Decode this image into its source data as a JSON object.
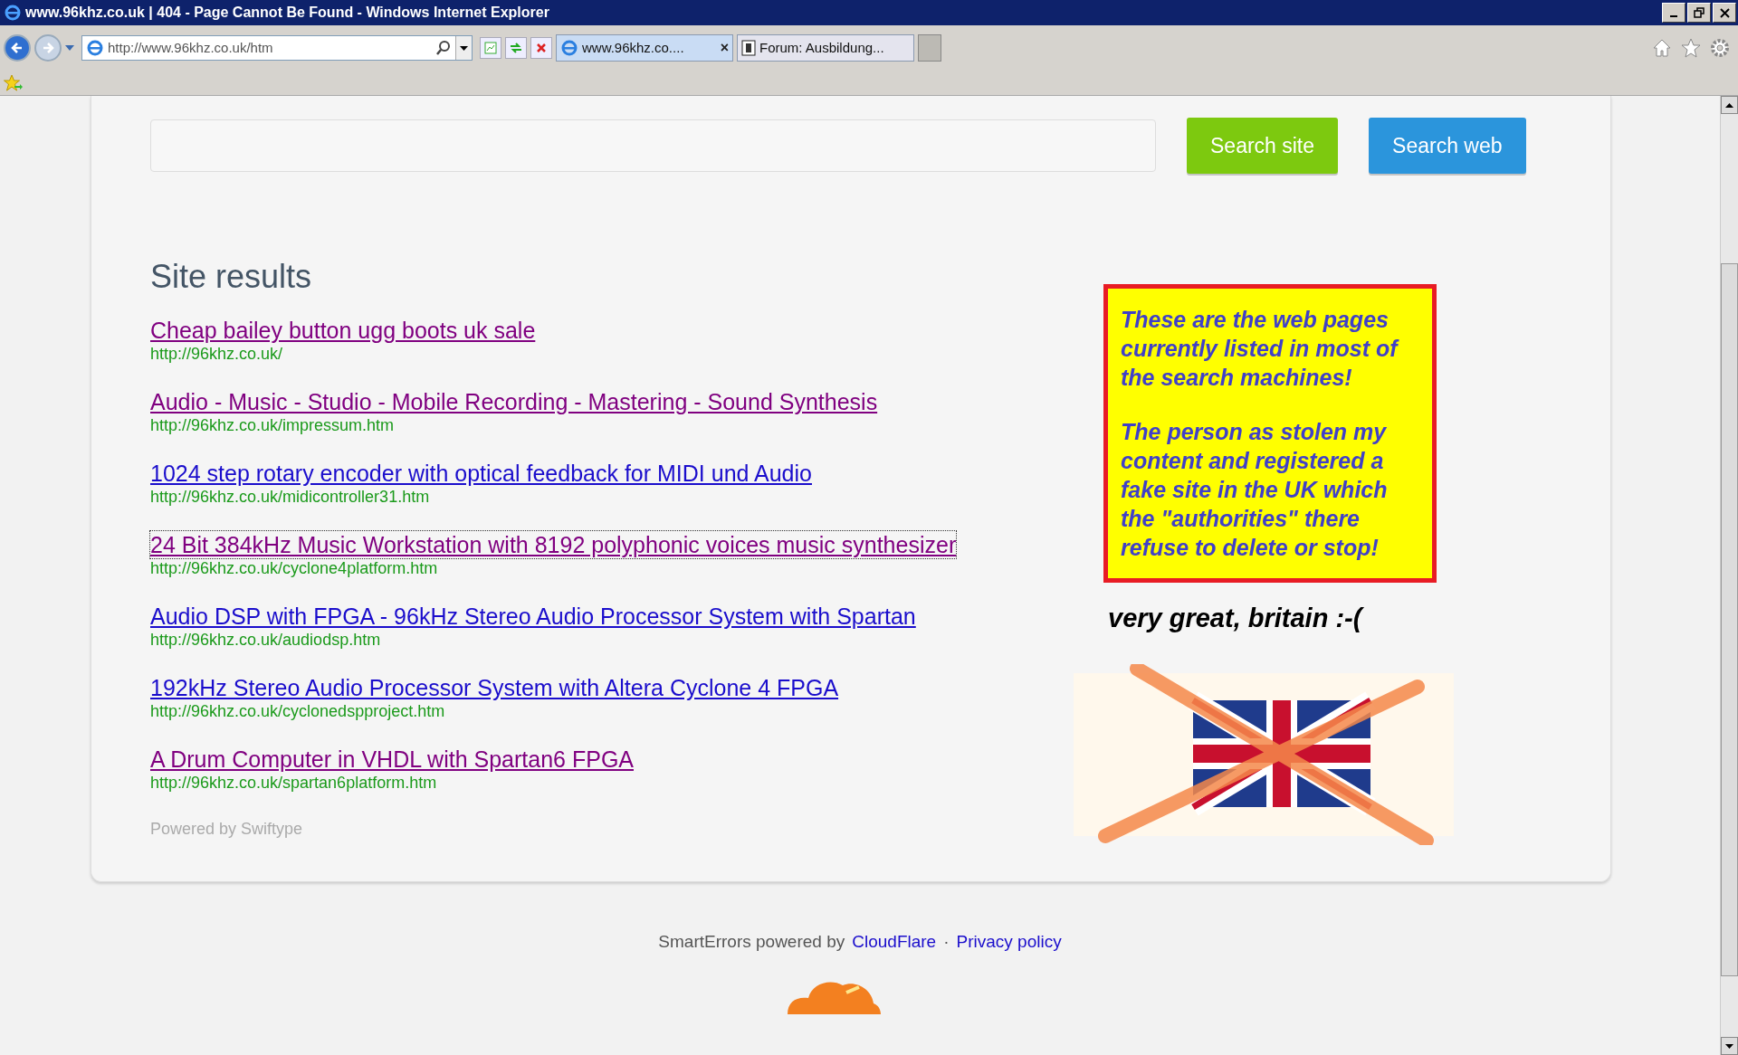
{
  "window": {
    "title": "www.96khz.co.uk | 404 - Page Cannot Be Found - Windows Internet Explorer"
  },
  "address_bar": {
    "value": "http://www.96khz.co.uk/htm"
  },
  "tabs": [
    {
      "label": "www.96khz.co....",
      "selected": true,
      "close": "×"
    },
    {
      "label": "Forum: Ausbildung...",
      "selected": false
    }
  ],
  "search": {
    "buttons": [
      {
        "label": "Search site",
        "color": "#7dc90f"
      },
      {
        "label": "Search web",
        "color": "#2b95dc"
      }
    ]
  },
  "results": {
    "heading": "Site results",
    "items": [
      {
        "title": "Cheap bailey button ugg boots uk sale",
        "url": "http://96khz.co.uk/",
        "visited": true,
        "focused": false
      },
      {
        "title": "Audio - Music - Studio - Mobile Recording - Mastering - Sound Synthesis",
        "url": "http://96khz.co.uk/impressum.htm",
        "visited": true,
        "focused": false
      },
      {
        "title": "1024 step rotary encoder with optical feedback for MIDI und Audio",
        "url": "http://96khz.co.uk/midicontroller31.htm",
        "visited": false,
        "focused": false
      },
      {
        "title": "24 Bit 384kHz Music Workstation with 8192 polyphonic voices music synthesizer",
        "url": "http://96khz.co.uk/cyclone4platform.htm",
        "visited": true,
        "focused": true
      },
      {
        "title": "Audio DSP with FPGA - 96kHz Stereo Audio Processor System with Spartan",
        "url": "http://96khz.co.uk/audiodsp.htm",
        "visited": false,
        "focused": false
      },
      {
        "title": "192kHz Stereo Audio Processor System with Altera Cyclone 4 FPGA",
        "url": "http://96khz.co.uk/cyclonedspproject.htm",
        "visited": false,
        "focused": false
      },
      {
        "title": "A Drum Computer in VHDL with Spartan6 FPGA",
        "url": "http://96khz.co.uk/spartan6platform.htm",
        "visited": true,
        "focused": false
      }
    ],
    "powered_by": "Powered by Swiftype"
  },
  "notice": {
    "paragraphs": [
      "These are the web pages currently listed in most of the search machines!",
      "The person as stolen my content and registered a fake site in the UK which the \"authorities\" there refuse to delete or stop!"
    ],
    "caption": "very great, britain :-("
  },
  "footer": {
    "text": "SmartErrors powered by",
    "link": "CloudFlare",
    "separator": "·",
    "privacy": "Privacy policy"
  }
}
